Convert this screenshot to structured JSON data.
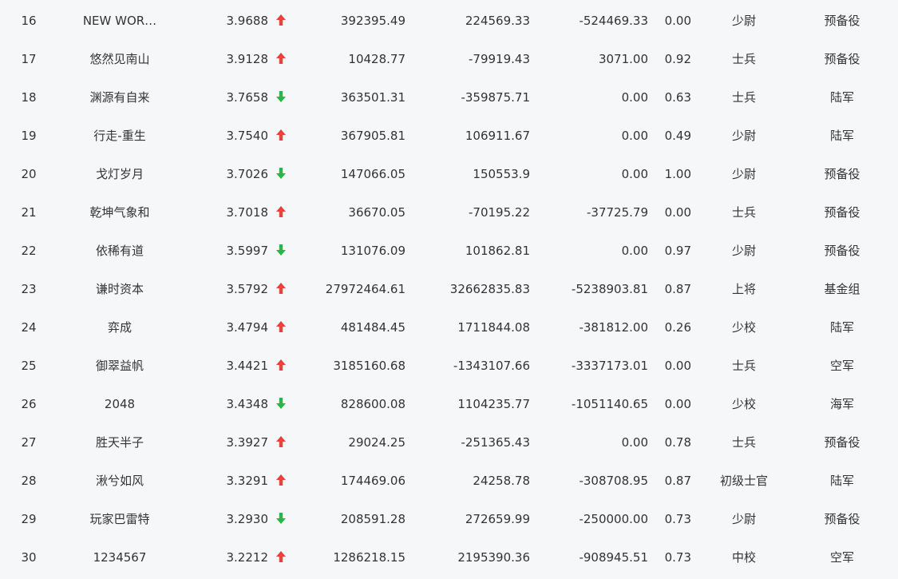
{
  "colors": {
    "up": "#e8423a",
    "down": "#2bb54a",
    "text": "#333333",
    "background": "#f6f7f9"
  },
  "rows": [
    {
      "rank": "16",
      "name": "NEW WOR…",
      "score": "3.9688",
      "trend": "up",
      "v1": "392395.49",
      "v2": "224569.33",
      "v3": "-524469.33",
      "v4": "0.00",
      "title": "少尉",
      "branch": "预备役"
    },
    {
      "rank": "17",
      "name": "悠然见南山",
      "score": "3.9128",
      "trend": "up",
      "v1": "10428.77",
      "v2": "-79919.43",
      "v3": "3071.00",
      "v4": "0.92",
      "title": "士兵",
      "branch": "预备役"
    },
    {
      "rank": "18",
      "name": "渊源有自来",
      "score": "3.7658",
      "trend": "down",
      "v1": "363501.31",
      "v2": "-359875.71",
      "v3": "0.00",
      "v4": "0.63",
      "title": "士兵",
      "branch": "陆军"
    },
    {
      "rank": "19",
      "name": "行走-重生",
      "score": "3.7540",
      "trend": "up",
      "v1": "367905.81",
      "v2": "106911.67",
      "v3": "0.00",
      "v4": "0.49",
      "title": "少尉",
      "branch": "陆军"
    },
    {
      "rank": "20",
      "name": "戈灯岁月",
      "score": "3.7026",
      "trend": "down",
      "v1": "147066.05",
      "v2": "150553.9",
      "v3": "0.00",
      "v4": "1.00",
      "title": "少尉",
      "branch": "预备役"
    },
    {
      "rank": "21",
      "name": "乾坤气象和",
      "score": "3.7018",
      "trend": "up",
      "v1": "36670.05",
      "v2": "-70195.22",
      "v3": "-37725.79",
      "v4": "0.00",
      "title": "士兵",
      "branch": "预备役"
    },
    {
      "rank": "22",
      "name": "依稀有道",
      "score": "3.5997",
      "trend": "down",
      "v1": "131076.09",
      "v2": "101862.81",
      "v3": "0.00",
      "v4": "0.97",
      "title": "少尉",
      "branch": "预备役"
    },
    {
      "rank": "23",
      "name": "谦时资本",
      "score": "3.5792",
      "trend": "up",
      "v1": "27972464.61",
      "v2": "32662835.83",
      "v3": "-5238903.81",
      "v4": "0.87",
      "title": "上将",
      "branch": "基金组"
    },
    {
      "rank": "24",
      "name": "弈成",
      "score": "3.4794",
      "trend": "up",
      "v1": "481484.45",
      "v2": "1711844.08",
      "v3": "-381812.00",
      "v4": "0.26",
      "title": "少校",
      "branch": "陆军"
    },
    {
      "rank": "25",
      "name": "御翠益帆",
      "score": "3.4421",
      "trend": "up",
      "v1": "3185160.68",
      "v2": "-1343107.66",
      "v3": "-3337173.01",
      "v4": "0.00",
      "title": "士兵",
      "branch": "空军"
    },
    {
      "rank": "26",
      "name": "2048",
      "score": "3.4348",
      "trend": "down",
      "v1": "828600.08",
      "v2": "1104235.77",
      "v3": "-1051140.65",
      "v4": "0.00",
      "title": "少校",
      "branch": "海军"
    },
    {
      "rank": "27",
      "name": "胜天半子",
      "score": "3.3927",
      "trend": "up",
      "v1": "29024.25",
      "v2": "-251365.43",
      "v3": "0.00",
      "v4": "0.78",
      "title": "士兵",
      "branch": "预备役"
    },
    {
      "rank": "28",
      "name": "湫兮如风",
      "score": "3.3291",
      "trend": "up",
      "v1": "174469.06",
      "v2": "24258.78",
      "v3": "-308708.95",
      "v4": "0.87",
      "title": "初级士官",
      "branch": "陆军"
    },
    {
      "rank": "29",
      "name": "玩家巴雷特",
      "score": "3.2930",
      "trend": "down",
      "v1": "208591.28",
      "v2": "272659.99",
      "v3": "-250000.00",
      "v4": "0.73",
      "title": "少尉",
      "branch": "预备役"
    },
    {
      "rank": "30",
      "name": "1234567",
      "score": "3.2212",
      "trend": "up",
      "v1": "1286218.15",
      "v2": "2195390.36",
      "v3": "-908945.51",
      "v4": "0.73",
      "title": "中校",
      "branch": "空军"
    }
  ]
}
